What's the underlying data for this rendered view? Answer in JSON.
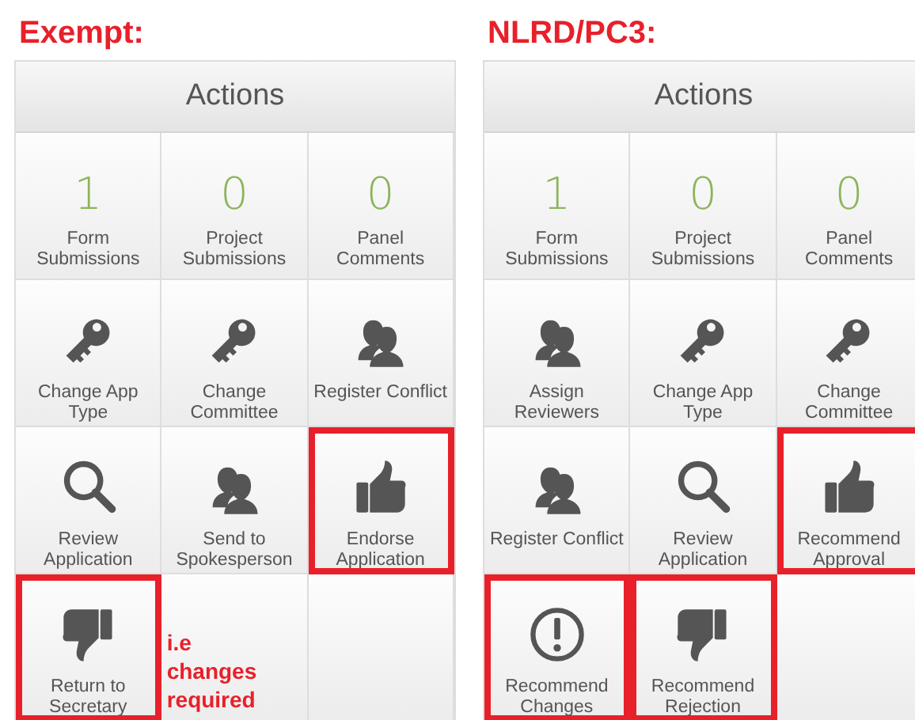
{
  "panels": [
    {
      "title": "Exempt:",
      "header": "Actions",
      "cells": [
        {
          "kind": "count",
          "value": "1",
          "label": "Form Submissions",
          "highlighted": false
        },
        {
          "kind": "count",
          "value": "0",
          "label": "Project Submissions",
          "highlighted": false
        },
        {
          "kind": "count",
          "value": "0",
          "label": "Panel Comments",
          "highlighted": false
        },
        {
          "kind": "key",
          "label": "Change App Type",
          "highlighted": false
        },
        {
          "kind": "key",
          "label": "Change Committee",
          "highlighted": false
        },
        {
          "kind": "people",
          "label": "Register Conflict",
          "highlighted": false
        },
        {
          "kind": "search",
          "label": "Review Application",
          "highlighted": false
        },
        {
          "kind": "people",
          "label": "Send to Spokesperson",
          "highlighted": false
        },
        {
          "kind": "thumbsup",
          "label": "Endorse Application",
          "highlighted": true
        },
        {
          "kind": "thumbsdown",
          "label": "Return to Secretary",
          "highlighted": true
        },
        {
          "kind": "note",
          "note": "i.e changes required",
          "highlighted": false
        },
        {
          "kind": "empty",
          "highlighted": false
        }
      ]
    },
    {
      "title": "NLRD/PC3:",
      "header": "Actions",
      "cells": [
        {
          "kind": "count",
          "value": "1",
          "label": "Form Submissions",
          "highlighted": false
        },
        {
          "kind": "count",
          "value": "0",
          "label": "Project Submissions",
          "highlighted": false
        },
        {
          "kind": "count",
          "value": "0",
          "label": "Panel Comments",
          "highlighted": false
        },
        {
          "kind": "people",
          "label": "Assign Reviewers",
          "highlighted": false
        },
        {
          "kind": "key",
          "label": "Change App Type",
          "highlighted": false
        },
        {
          "kind": "key",
          "label": "Change Committee",
          "highlighted": false
        },
        {
          "kind": "people",
          "label": "Register Conflict",
          "highlighted": false
        },
        {
          "kind": "search",
          "label": "Review Application",
          "highlighted": false
        },
        {
          "kind": "thumbsup",
          "label": "Recommend Approval",
          "highlighted": true
        },
        {
          "kind": "alert",
          "label": "Recommend Changes",
          "highlighted": true
        },
        {
          "kind": "thumbsdown",
          "label": "Recommend Rejection",
          "highlighted": true
        },
        {
          "kind": "empty",
          "highlighted": false
        }
      ]
    }
  ]
}
